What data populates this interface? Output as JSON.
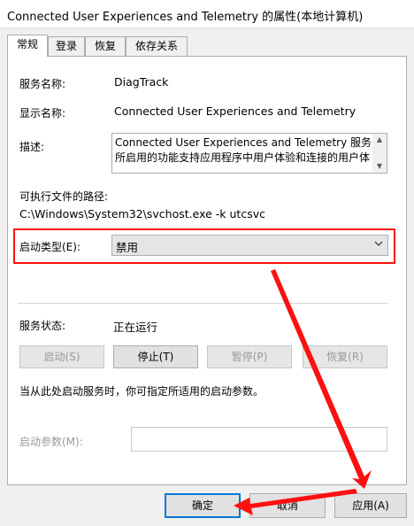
{
  "window": {
    "title": "Connected User Experiences and Telemetry 的属性(本地计算机)"
  },
  "tabs": [
    {
      "label": "常规",
      "active": true
    },
    {
      "label": "登录"
    },
    {
      "label": "恢复"
    },
    {
      "label": "依存关系"
    }
  ],
  "general": {
    "service_name_label": "服务名称:",
    "service_name": "DiagTrack",
    "display_name_label": "显示名称:",
    "display_name": "Connected User Experiences and Telemetry",
    "description_label": "描述:",
    "description_line1": "Connected User Experiences and Telemetry 服务",
    "description_line2": "所启用的功能支持应用程序中用户体验和连接的用户体",
    "exe_path_label": "可执行文件的路径:",
    "exe_path": "C:\\Windows\\System32\\svchost.exe -k utcsvc",
    "startup_type_label": "启动类型(E):",
    "startup_type_value": "禁用",
    "service_status_label": "服务状态:",
    "service_status_value": "正在运行",
    "buttons": {
      "start": "启动(S)",
      "stop": "停止(T)",
      "pause": "暂停(P)",
      "resume": "恢复(R)"
    },
    "hint": "当从此处启动服务时，你可指定所适用的启动参数。",
    "start_params_label": "启动参数(M):",
    "start_params_value": ""
  },
  "footer": {
    "ok": "确定",
    "cancel": "取消",
    "apply": "应用(A)"
  },
  "colors": {
    "annotation_red": "#ff1010",
    "default_button_border": "#0078d7"
  }
}
